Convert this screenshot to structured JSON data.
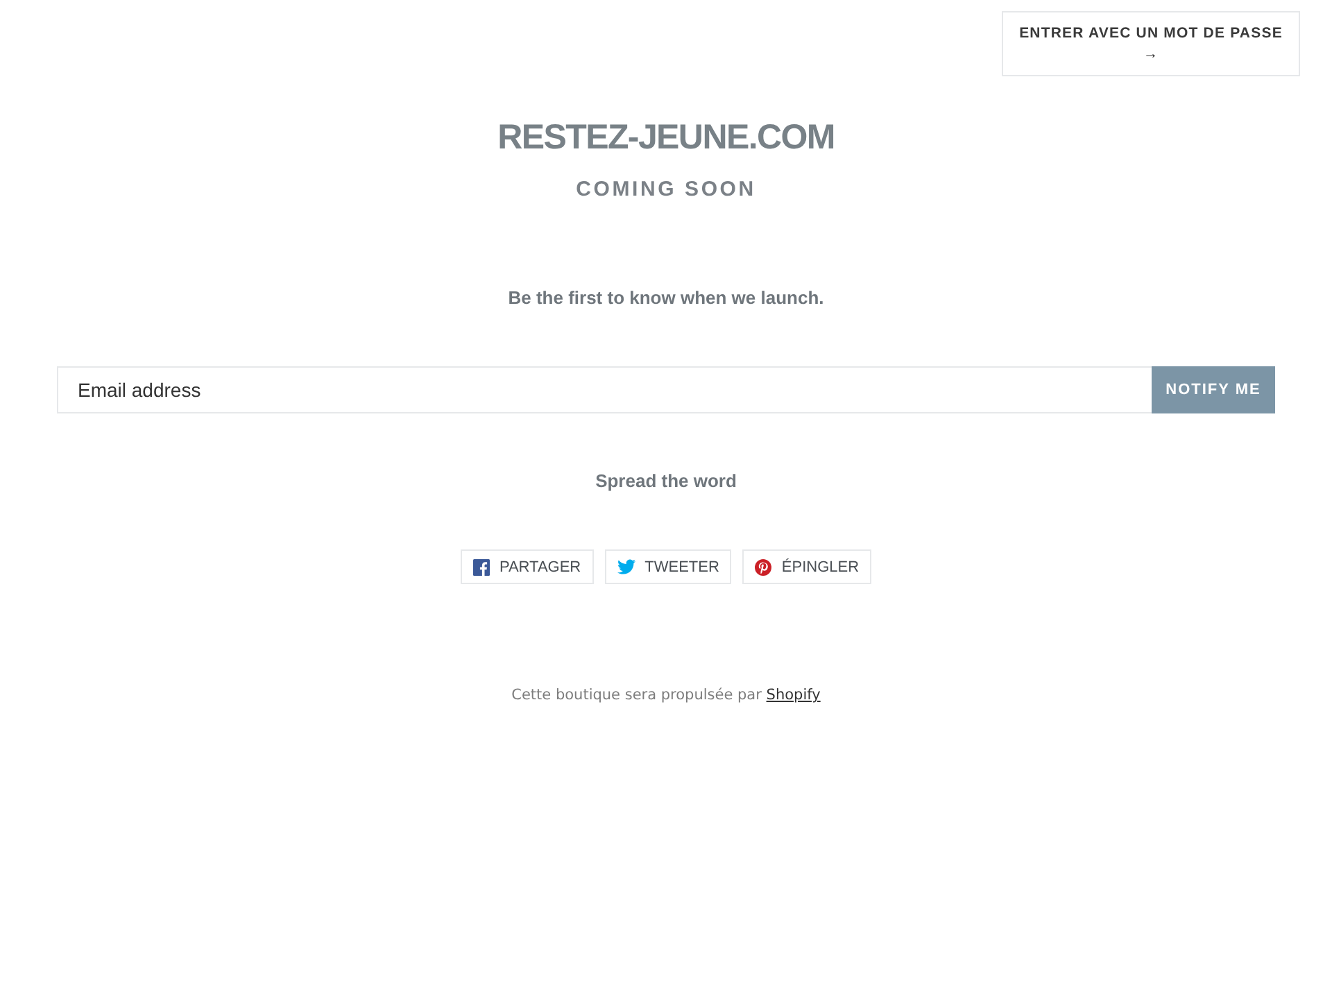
{
  "password_button": {
    "label": "ENTRER AVEC UN MOT DE PASSE",
    "arrow": "→"
  },
  "header": {
    "title": "RESTEZ-JEUNE.COM",
    "subtitle": "COMING SOON"
  },
  "signup": {
    "tagline": "Be the first to know when we launch.",
    "email": {
      "placeholder": "Email address"
    },
    "button": "NOTIFY ME"
  },
  "share": {
    "heading": "Spread the word",
    "buttons": [
      {
        "kind": "facebook",
        "label": "PARTAGER"
      },
      {
        "kind": "twitter",
        "label": "TWEETER"
      },
      {
        "kind": "pinterest",
        "label": "ÉPINGLER"
      }
    ]
  },
  "footer": {
    "text": "Cette boutique sera propulsée par",
    "link": "Shopify"
  }
}
